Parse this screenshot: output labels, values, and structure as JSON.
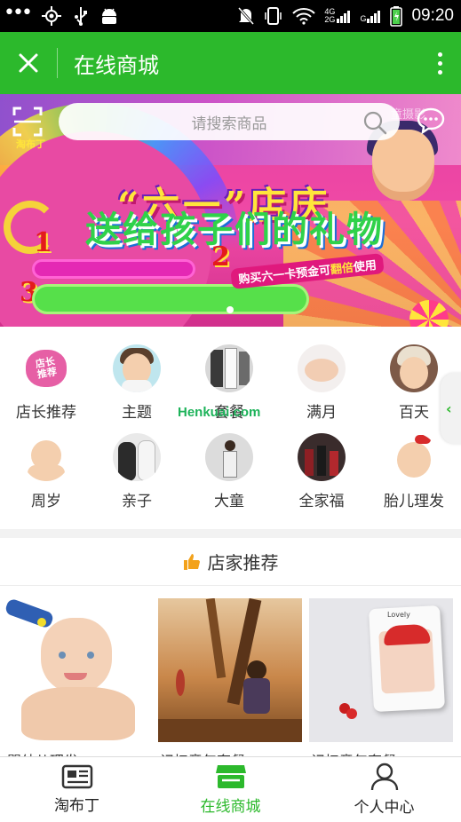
{
  "status_bar": {
    "time": "09:20",
    "network_label_top": "4G",
    "network_label_bottom": "2G",
    "network_label_left": "G",
    "battery_icon": "battery-charging-icon"
  },
  "app_bar": {
    "title": "在线商城",
    "close_icon": "close-icon",
    "more_icon": "more-vertical-icon"
  },
  "header": {
    "search_placeholder": "请搜索商品",
    "logo_text": "淘布丁",
    "corner_text": "童摄影"
  },
  "banner": {
    "headline_1": "“六一”店庆",
    "headline_2": "送给孩子们的礼物",
    "num_1": "1",
    "num_2": "2",
    "num_3": "3",
    "promo_text_a": "购买六一卡预金可",
    "promo_text_b": "翻倍",
    "promo_text_c": "使用",
    "active_slide": 1,
    "slide_count": 1
  },
  "categories": {
    "row1": [
      {
        "label": "店长推荐"
      },
      {
        "label": "主题"
      },
      {
        "label": "套餐"
      },
      {
        "label": "满月"
      },
      {
        "label": "百天"
      }
    ],
    "row2": [
      {
        "label": "周岁"
      },
      {
        "label": "亲子"
      },
      {
        "label": "大童"
      },
      {
        "label": "全家福"
      },
      {
        "label": "胎儿理发"
      }
    ],
    "badge_text_1": "店长",
    "badge_text_2": "推荐",
    "watermark": "Henkuai.com"
  },
  "recommend": {
    "title": "店家推荐",
    "products": [
      {
        "name": "婴幼儿理发"
      },
      {
        "name": "记忆童年套餐B"
      },
      {
        "name": "记忆童年套餐A"
      }
    ],
    "frame_caption": "Lovely"
  },
  "tab_bar": {
    "tabs": [
      {
        "label": "淘布丁"
      },
      {
        "label": "在线商城"
      },
      {
        "label": "个人中心"
      }
    ],
    "active_index": 1
  },
  "colors": {
    "brand_green": "#2cb92c",
    "status_bar": "#000000",
    "banner_pink": "#e84aa3"
  }
}
